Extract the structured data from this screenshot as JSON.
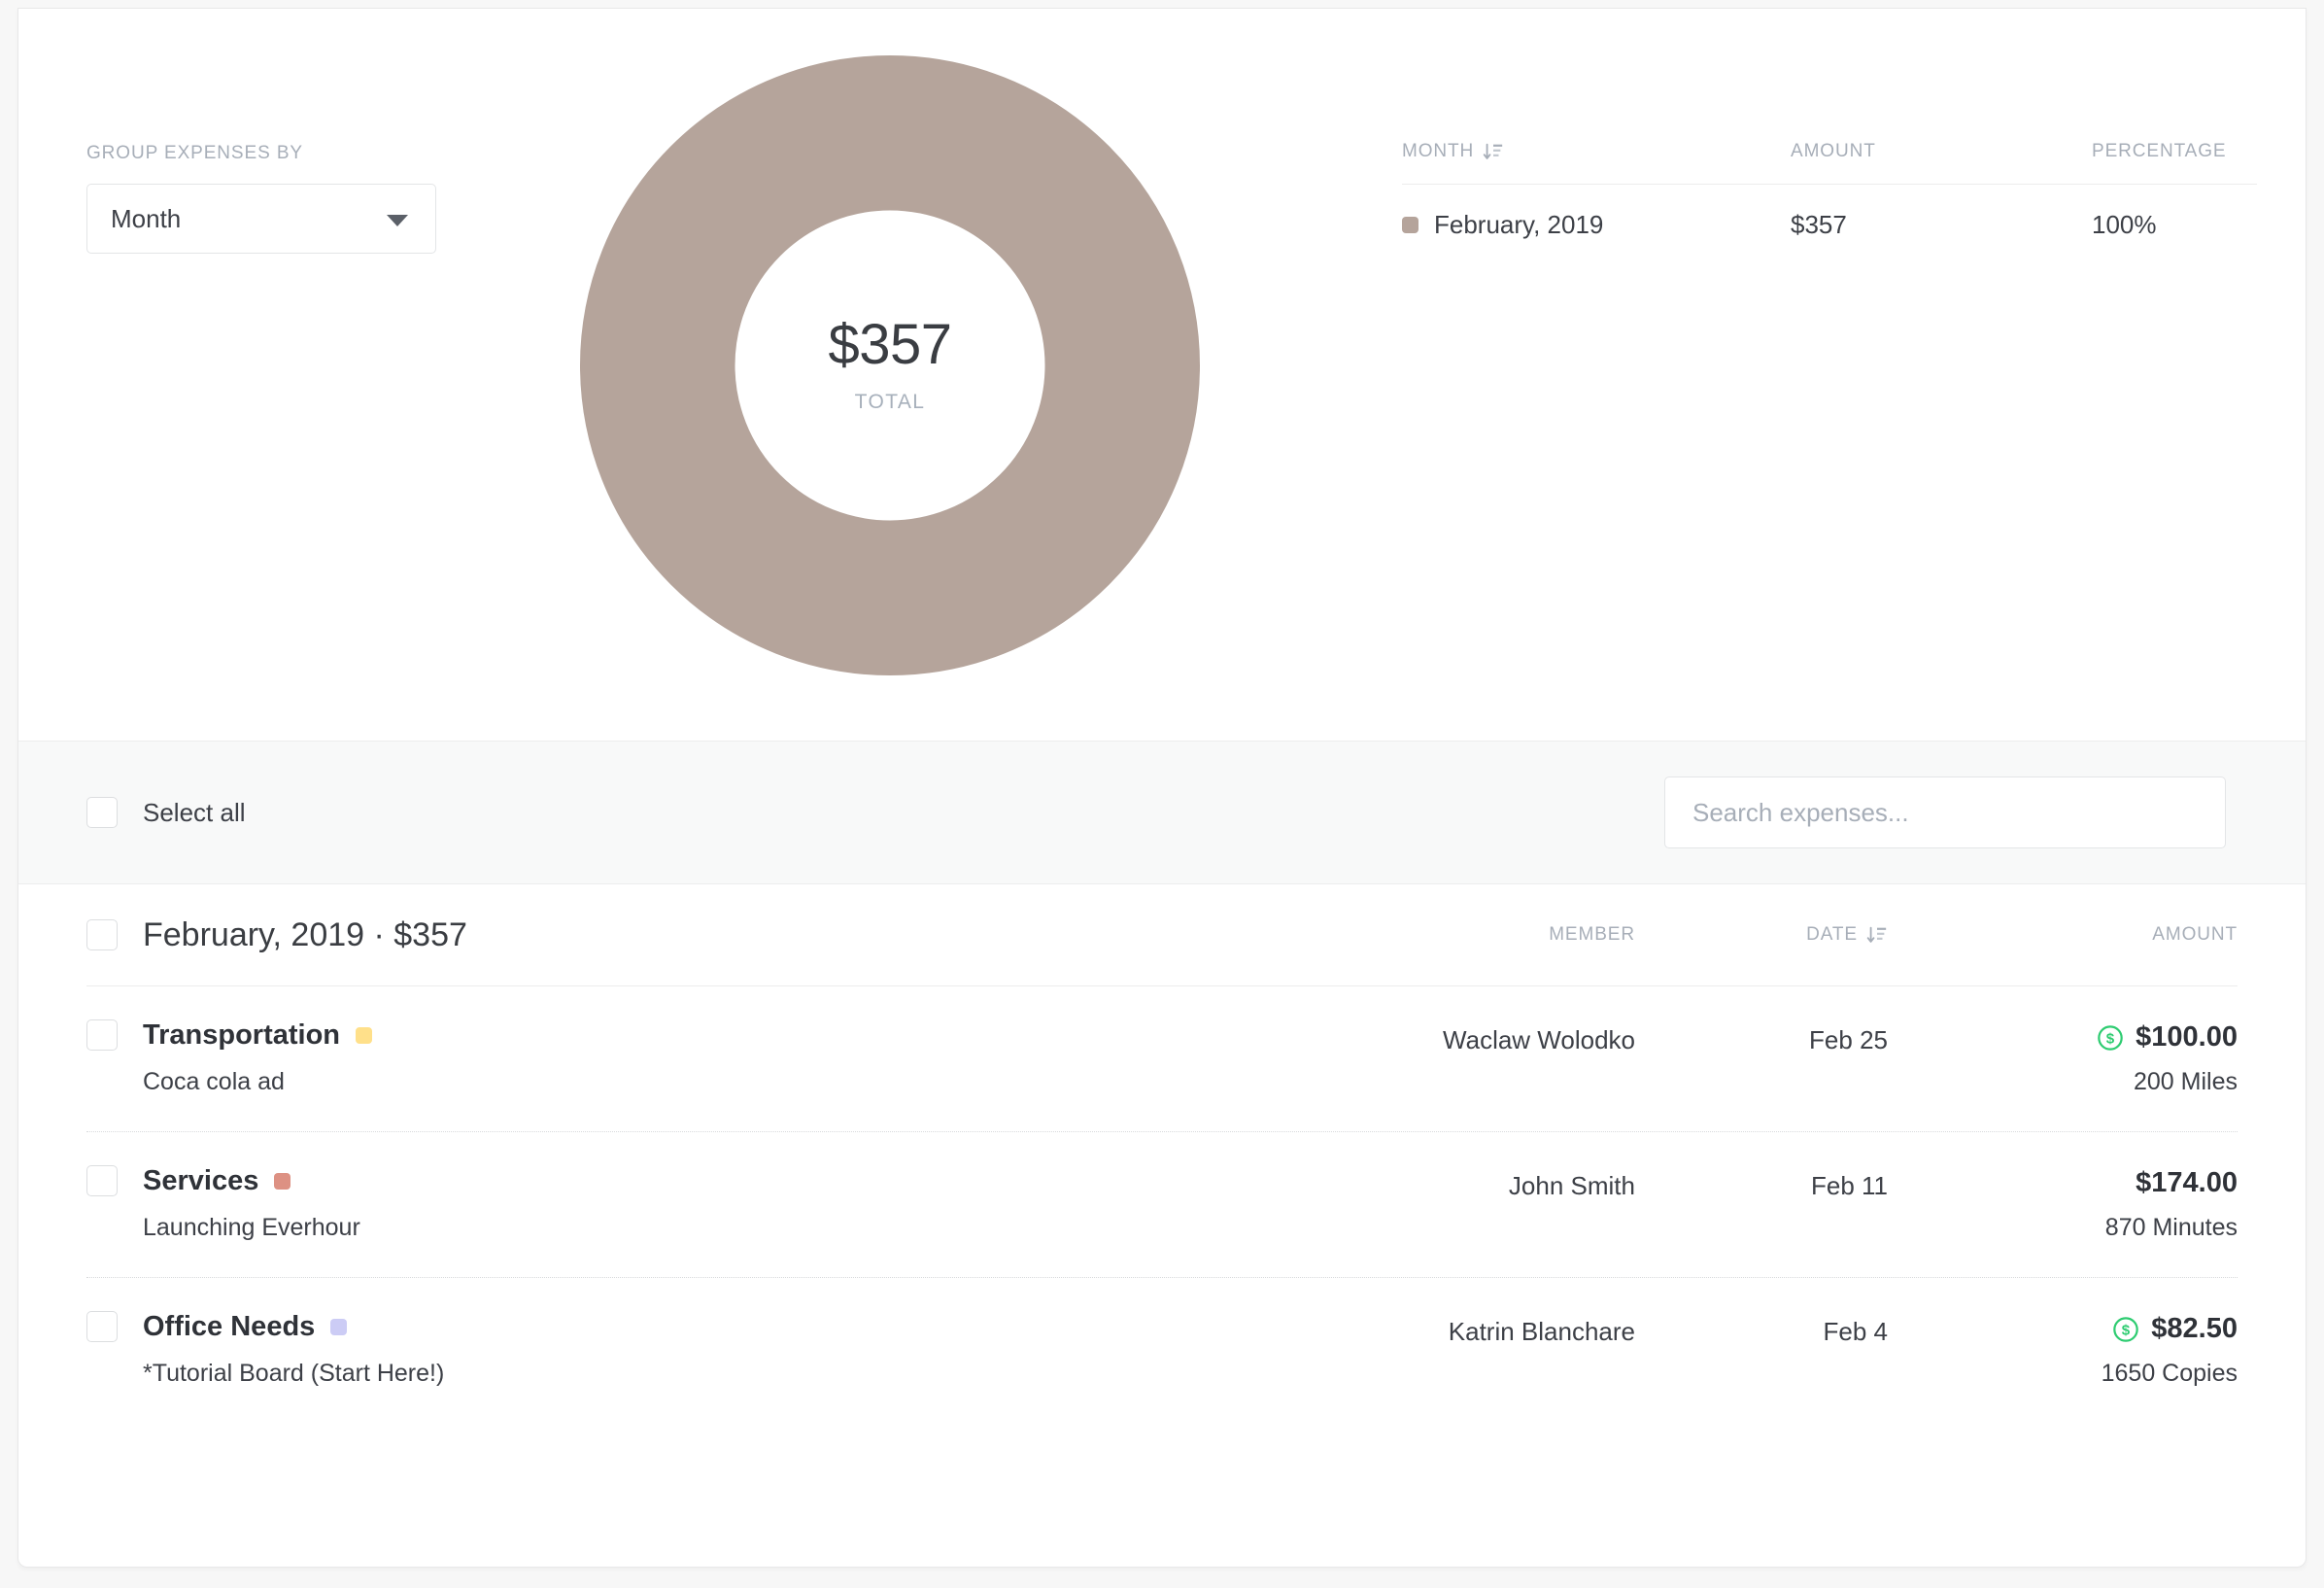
{
  "colors": {
    "donut_segment": "#b5a49b",
    "accent_green": "#2ecc71",
    "tag_yellow": "#ffe08a",
    "tag_red": "#dd9183",
    "tag_purple": "#ccccf5",
    "muted_text": "#a7aeb8"
  },
  "summary": {
    "group_by_label": "GROUP EXPENSES BY",
    "group_by_value": "Month",
    "group_by_caret_icon": "chevron-down-icon",
    "donut": {
      "total_value": "$357",
      "total_label": "TOTAL"
    },
    "legend": {
      "headers": {
        "name": "MONTH",
        "amount": "AMOUNT",
        "percentage": "PERCENTAGE",
        "sort_icon": "sort-descending-icon"
      },
      "rows": [
        {
          "swatch": "#b5a49b",
          "name": "February, 2019",
          "amount": "$357",
          "percentage": "100%"
        }
      ]
    }
  },
  "toolbar": {
    "select_all_label": "Select all",
    "select_all_checkbox_icon": "checkbox-unchecked-icon",
    "search_placeholder": "Search expenses...",
    "search_value": ""
  },
  "list": {
    "group": {
      "checkbox_icon": "checkbox-unchecked-icon",
      "title": "February, 2019 · $357",
      "headers": {
        "member": "MEMBER",
        "date": "DATE",
        "amount": "AMOUNT",
        "date_sort_icon": "sort-descending-icon"
      }
    },
    "rows": [
      {
        "checkbox_icon": "checkbox-unchecked-icon",
        "name": "Transportation",
        "swatch": "#ffe08a",
        "description": "Coca cola ad",
        "member": "Waclaw Wolodko",
        "date": "Feb 25",
        "billable": true,
        "billable_icon": "dollar-circle-icon",
        "amount": "$100.00",
        "sub": "200 Miles"
      },
      {
        "checkbox_icon": "checkbox-unchecked-icon",
        "name": "Services",
        "swatch": "#dd9183",
        "description": "Launching Everhour",
        "member": "John Smith",
        "date": "Feb 11",
        "billable": false,
        "billable_icon": "",
        "amount": "$174.00",
        "sub": "870 Minutes"
      },
      {
        "checkbox_icon": "checkbox-unchecked-icon",
        "name": "Office Needs",
        "swatch": "#ccccf5",
        "description": "*Tutorial Board (Start Here!)",
        "member": "Katrin Blanchare",
        "date": "Feb 4",
        "billable": true,
        "billable_icon": "dollar-circle-icon",
        "amount": "$82.50",
        "sub": "1650 Copies"
      }
    ]
  },
  "chart_data": {
    "type": "pie",
    "title": "Expenses grouped by Month",
    "subtitle": "$357 TOTAL",
    "donut": true,
    "inner_radius_ratio": 0.527,
    "categories": [
      "February, 2019"
    ],
    "values": [
      357
    ],
    "percentages": [
      100
    ],
    "value_labels": [
      "$357"
    ],
    "percentage_labels": [
      "100%"
    ],
    "colors": [
      "#b5a49b"
    ],
    "center_label": "$357",
    "center_sublabel": "TOTAL",
    "unit": "USD",
    "legend": "right",
    "legend_columns": [
      "MONTH",
      "AMOUNT",
      "PERCENTAGE"
    ],
    "grid": false
  }
}
